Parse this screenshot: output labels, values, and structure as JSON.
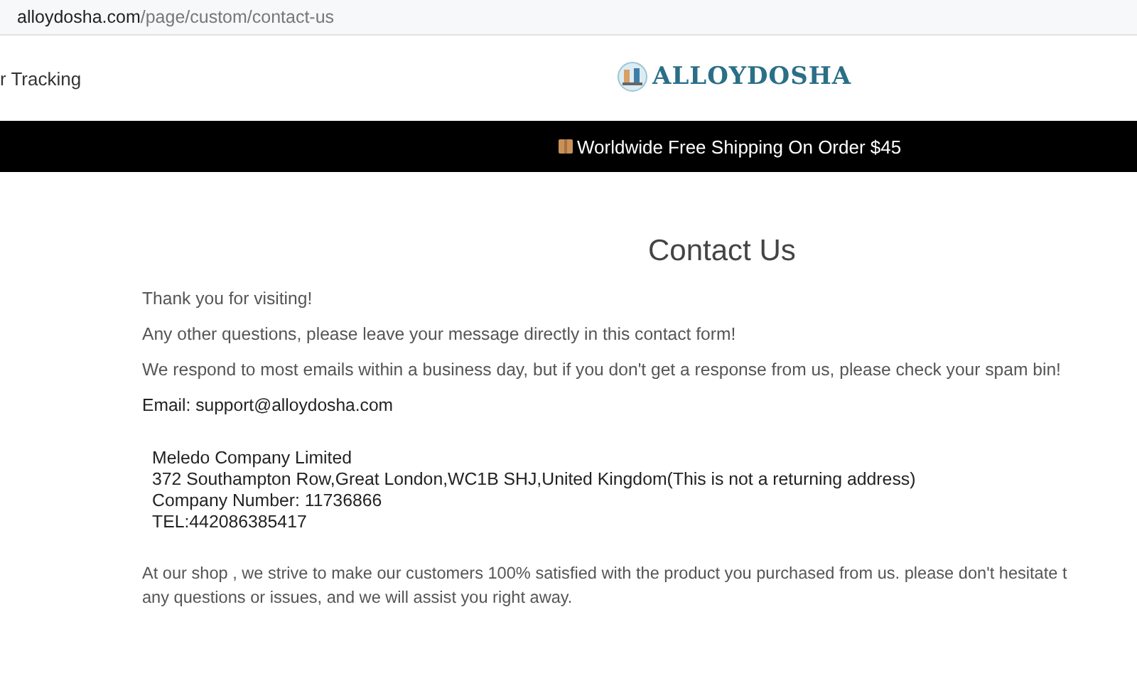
{
  "address_bar": {
    "domain": "alloydosha.com",
    "path": "/page/custom/contact-us"
  },
  "header": {
    "nav_link": "r Tracking",
    "logo_text": "ALLOYDOSHA"
  },
  "announcement": {
    "text": "Worldwide Free Shipping On Order $45"
  },
  "page_title": "Contact Us",
  "paragraphs": [
    "Thank you for visiting!",
    "Any other questions, please leave your message directly in this contact form!",
    "We respond to most emails within a business day, but if you don't get a response from us, please check your spam bin!"
  ],
  "email": "Email: support@alloydosha.com",
  "company_lines": [
    "Meledo Company Limited",
    "372 Southampton Row,Great London,WC1B SHJ,United Kingdom(This is not a returning address)",
    "Company Number:  11736866",
    "TEL:442086385417"
  ],
  "closing_lines": [
    "At our shop , we strive to make our customers 100% satisfied with the product you purchased from us. please don't hesitate t",
    "any questions or issues, and we will assist you right away."
  ]
}
